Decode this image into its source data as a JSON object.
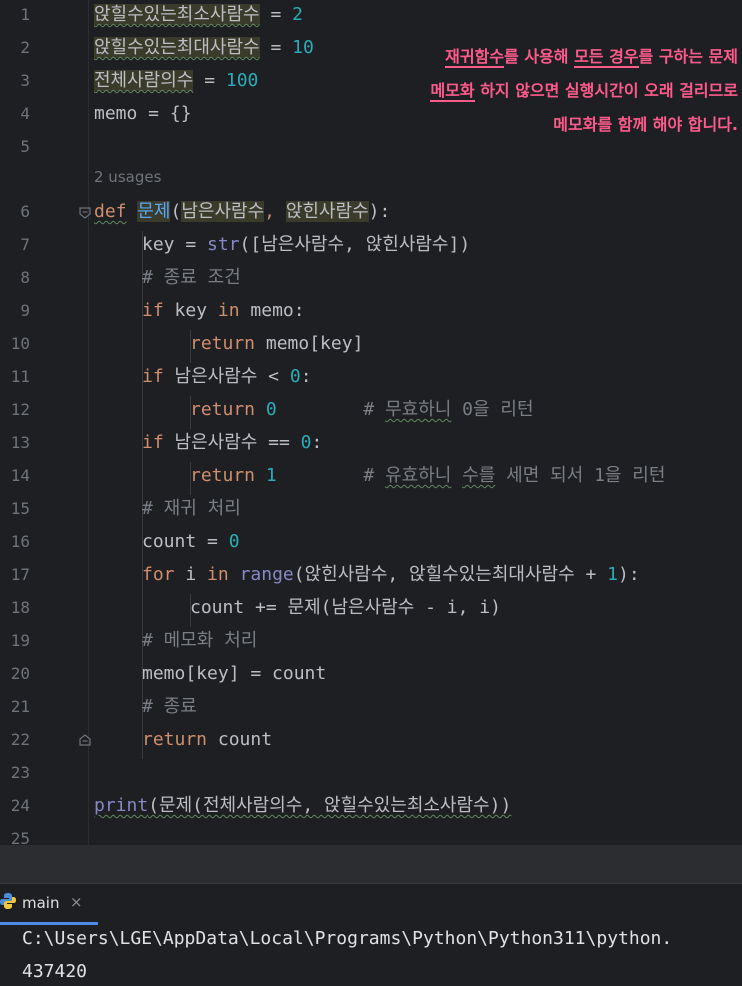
{
  "editor": {
    "line_numbers": [
      "1",
      "2",
      "3",
      "4",
      "5",
      "6",
      "7",
      "8",
      "9",
      "10",
      "11",
      "12",
      "13",
      "14",
      "15",
      "16",
      "17",
      "18",
      "19",
      "20",
      "21",
      "22",
      "23",
      "24",
      "25"
    ],
    "usages_hint": "2 usages",
    "code": {
      "l1_var": "앉힐수있는최소사람수",
      "l1_op": " = ",
      "l1_val": "2",
      "l2_var": "앉힐수있는최대사람수",
      "l2_op": " = ",
      "l2_val": "10",
      "l3_var": "전체사람의수",
      "l3_op": " = ",
      "l3_val": "100",
      "l4": "memo = {}",
      "l6_def": "def",
      "l6_sp": " ",
      "l6_fn": "문제",
      "l6_open": "(",
      "l6_p1": "남은사람수",
      "l6_comma": ", ",
      "l6_p2": "앉힌사람수",
      "l6_close": "):",
      "l7_a": "key = ",
      "l7_str": "str",
      "l7_b": "([남은사람수, 앉힌사람수])",
      "l8": "# 종료 조건",
      "l9_if": "if",
      "l9_a": " key ",
      "l9_in": "in",
      "l9_b": " memo:",
      "l10_ret": "return",
      "l10_b": " memo[key]",
      "l11_if": "if",
      "l11_a": " 남은사람수 < ",
      "l11_num": "0",
      "l11_b": ":",
      "l12_ret": "return",
      "l12_sp": " ",
      "l12_num": "0",
      "l12_cm_a": "        # ",
      "l12_cm_u": "무효하니",
      "l12_cm_b": " 0을 리턴",
      "l13_if": "if",
      "l13_a": " 남은사람수 == ",
      "l13_num": "0",
      "l13_b": ":",
      "l14_ret": "return",
      "l14_sp": " ",
      "l14_num": "1",
      "l14_cm_a": "        # ",
      "l14_cm_u1": "유효하니",
      "l14_cm_sp": " ",
      "l14_cm_u2": "수를",
      "l14_cm_b": " 세면 되서 1을 리턴",
      "l15": "# 재귀 처리",
      "l16_a": "count = ",
      "l16_num": "0",
      "l17_for": "for",
      "l17_a": " i ",
      "l17_in": "in",
      "l17_sp": " ",
      "l17_range": "range",
      "l17_b": "(앉힌사람수, 앉힐수있는최대사람수 + ",
      "l17_num": "1",
      "l17_c": "):",
      "l18": "count += 문제(남은사람수 - i, i)",
      "l19": "# 메모화 처리",
      "l20": "memo[key] = count",
      "l21": "# 종료",
      "l22_ret": "return",
      "l22_b": " count",
      "l24_print": "print",
      "l24_b": "(문제(전체사람의수, 앉힐수있는최소사람수))"
    }
  },
  "annotation": {
    "line1_u1": "재귀함수",
    "line1_a": "를 사용해 ",
    "line1_u2": "모든 경우",
    "line1_b": "를 구하는 문제",
    "line2_u": "메모화",
    "line2_b": " 하지 않으면 실행시간이 오래 걸리므로",
    "line3": "메모화를 함께 해야 합니다."
  },
  "run_panel": {
    "tab_label": "main",
    "tab_close": "×",
    "output_path": "C:\\Users\\LGE\\AppData\\Local\\Programs\\Python\\Python311\\python.",
    "output_result": "437420"
  },
  "colors": {
    "background": "#1e1f22",
    "keyword": "#cf8e6d",
    "number": "#2aacb8",
    "function": "#56a8f5",
    "annotation": "#ff5a8c"
  }
}
